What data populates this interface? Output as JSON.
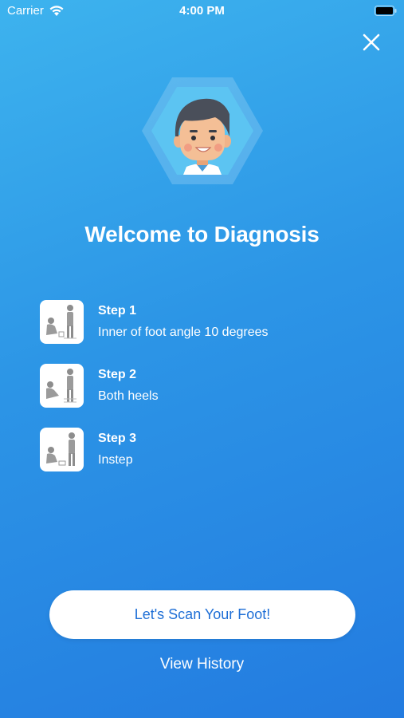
{
  "status_bar": {
    "carrier": "Carrier",
    "time": "4:00 PM"
  },
  "header": {
    "close_icon": "close-icon"
  },
  "avatar": {
    "icon": "doctor-avatar-icon"
  },
  "title": "Welcome to Diagnosis",
  "steps": [
    {
      "title": "Step 1",
      "description": "Inner of foot angle 10 degrees",
      "icon": "step-illustration-icon"
    },
    {
      "title": "Step 2",
      "description": "Both heels",
      "icon": "step-illustration-icon"
    },
    {
      "title": "Step 3",
      "description": "Instep",
      "icon": "step-illustration-icon"
    }
  ],
  "actions": {
    "scan_label": "Let's Scan Your Foot!",
    "history_label": "View History"
  },
  "colors": {
    "gradient_top": "#3db3ee",
    "gradient_bottom": "#237be0",
    "button_text": "#1f6fd6",
    "white": "#ffffff"
  }
}
